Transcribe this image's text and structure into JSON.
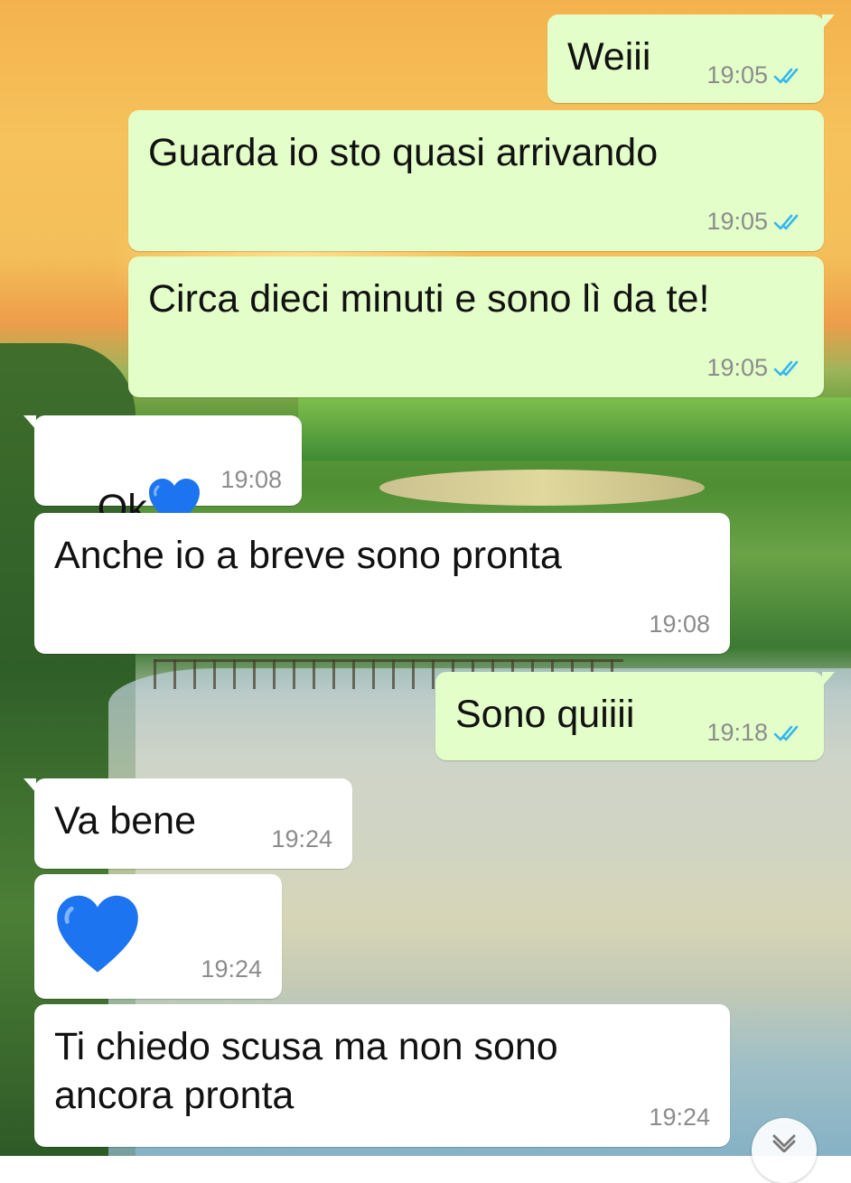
{
  "chat": {
    "messages": [
      {
        "direction": "out",
        "text": "Weiii",
        "time": "19:05",
        "status": "read"
      },
      {
        "direction": "out",
        "text": "Guarda io sto quasi arrivando",
        "time": "19:05",
        "status": "read"
      },
      {
        "direction": "out",
        "text": "Circa dieci minuti e sono lì da te!",
        "time": "19:05",
        "status": "read"
      },
      {
        "direction": "in",
        "text": "Ok",
        "emoji": "blue-heart",
        "time": "19:08"
      },
      {
        "direction": "in",
        "text": "Anche io a breve sono pronta",
        "time": "19:08"
      },
      {
        "direction": "out",
        "text": "Sono quiiii",
        "time": "19:18",
        "status": "read"
      },
      {
        "direction": "in",
        "text": "Va bene",
        "time": "19:24"
      },
      {
        "direction": "in",
        "emoji": "blue-heart",
        "time": "19:24"
      },
      {
        "direction": "in",
        "text": "Ti chiedo scusa ma non sono\nancora pronta",
        "time": "19:24"
      }
    ]
  },
  "colors": {
    "outgoing_bubble": "#e3fec8",
    "incoming_bubble": "#ffffff",
    "read_ticks": "#34b7f1",
    "heart": "#1d74f0"
  },
  "icons": {
    "read_receipt": "double-check-icon",
    "heart": "blue-heart-icon",
    "scroll": "chevron-down-icon"
  }
}
